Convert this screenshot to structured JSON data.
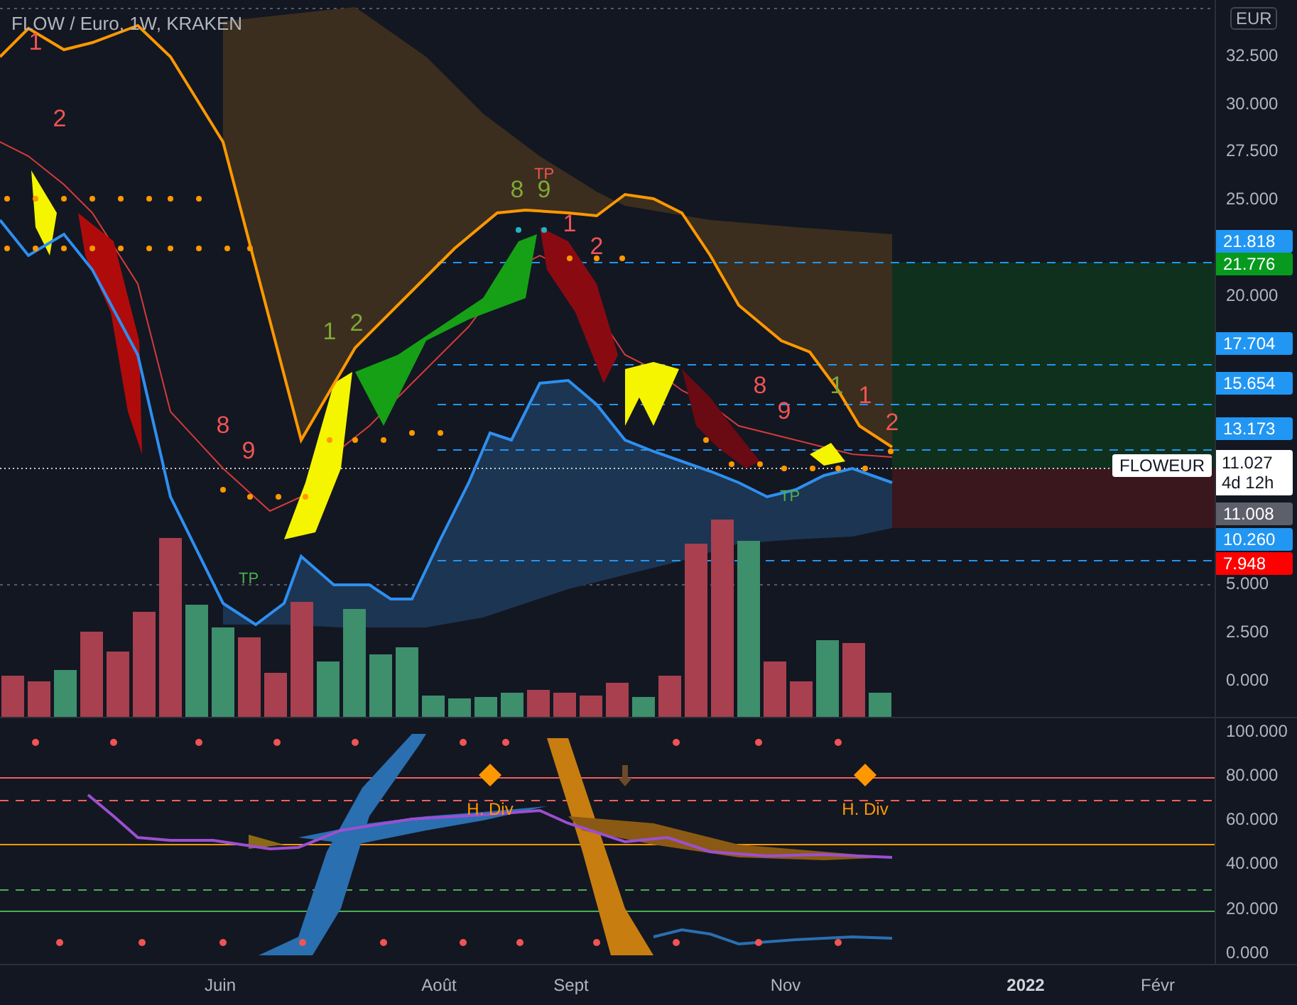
{
  "header": {
    "title": "FLOW / Euro, 1W, KRAKEN"
  },
  "currency": "EUR",
  "price_axis": {
    "ticks": [
      "32.500",
      "30.000",
      "27.500",
      "25.000",
      "20.000",
      "5.000",
      "2.500",
      "0.000"
    ]
  },
  "price_tags": [
    {
      "text": "21.818",
      "color": "#2196f3"
    },
    {
      "text": "21.776",
      "color": "#089a1e"
    },
    {
      "text": "17.704",
      "color": "#2196f3"
    },
    {
      "text": "15.654",
      "color": "#2196f3"
    },
    {
      "text": "13.173",
      "color": "#2196f3"
    },
    {
      "text": "11.008",
      "color": "#5d606b"
    },
    {
      "text": "10.260",
      "color": "#2196f3"
    },
    {
      "text": "7.948",
      "color": "#ff0000"
    }
  ],
  "last_price": {
    "symbol": "FLOWEUR",
    "price": "11.027",
    "countdown": "4d 12h"
  },
  "markers": [
    {
      "text": "1",
      "color": "#f05454"
    },
    {
      "text": "2",
      "color": "#f05454"
    },
    {
      "text": "8",
      "color": "#f05454"
    },
    {
      "text": "9",
      "color": "#f05454"
    },
    {
      "text": "TP",
      "color": "#4caf50"
    },
    {
      "text": "1",
      "color": "#7fa836"
    },
    {
      "text": "2",
      "color": "#7fa836"
    },
    {
      "text": "8",
      "color": "#7fa836"
    },
    {
      "text": "9",
      "color": "#7fa836"
    },
    {
      "text": "TP",
      "color": "#f05454"
    },
    {
      "text": "1",
      "color": "#f05454"
    },
    {
      "text": "2",
      "color": "#f05454"
    },
    {
      "text": "8",
      "color": "#f05454"
    },
    {
      "text": "9",
      "color": "#f05454"
    },
    {
      "text": "TP",
      "color": "#4caf50"
    },
    {
      "text": "1",
      "color": "#7fa836"
    },
    {
      "text": "1",
      "color": "#f05454"
    },
    {
      "text": "2",
      "color": "#f05454"
    }
  ],
  "oscillator": {
    "labels": [
      "H. Div",
      "H. Div"
    ],
    "ticks": [
      "100.000",
      "80.000",
      "60.000",
      "40.000",
      "20.000",
      "0.000"
    ]
  },
  "time_axis": [
    {
      "label": "Juin",
      "kind": "month"
    },
    {
      "label": "Août",
      "kind": "month"
    },
    {
      "label": "Sept",
      "kind": "month"
    },
    {
      "label": "Nov",
      "kind": "month"
    },
    {
      "label": "2022",
      "kind": "year"
    },
    {
      "label": "Févr",
      "kind": "month"
    }
  ]
}
